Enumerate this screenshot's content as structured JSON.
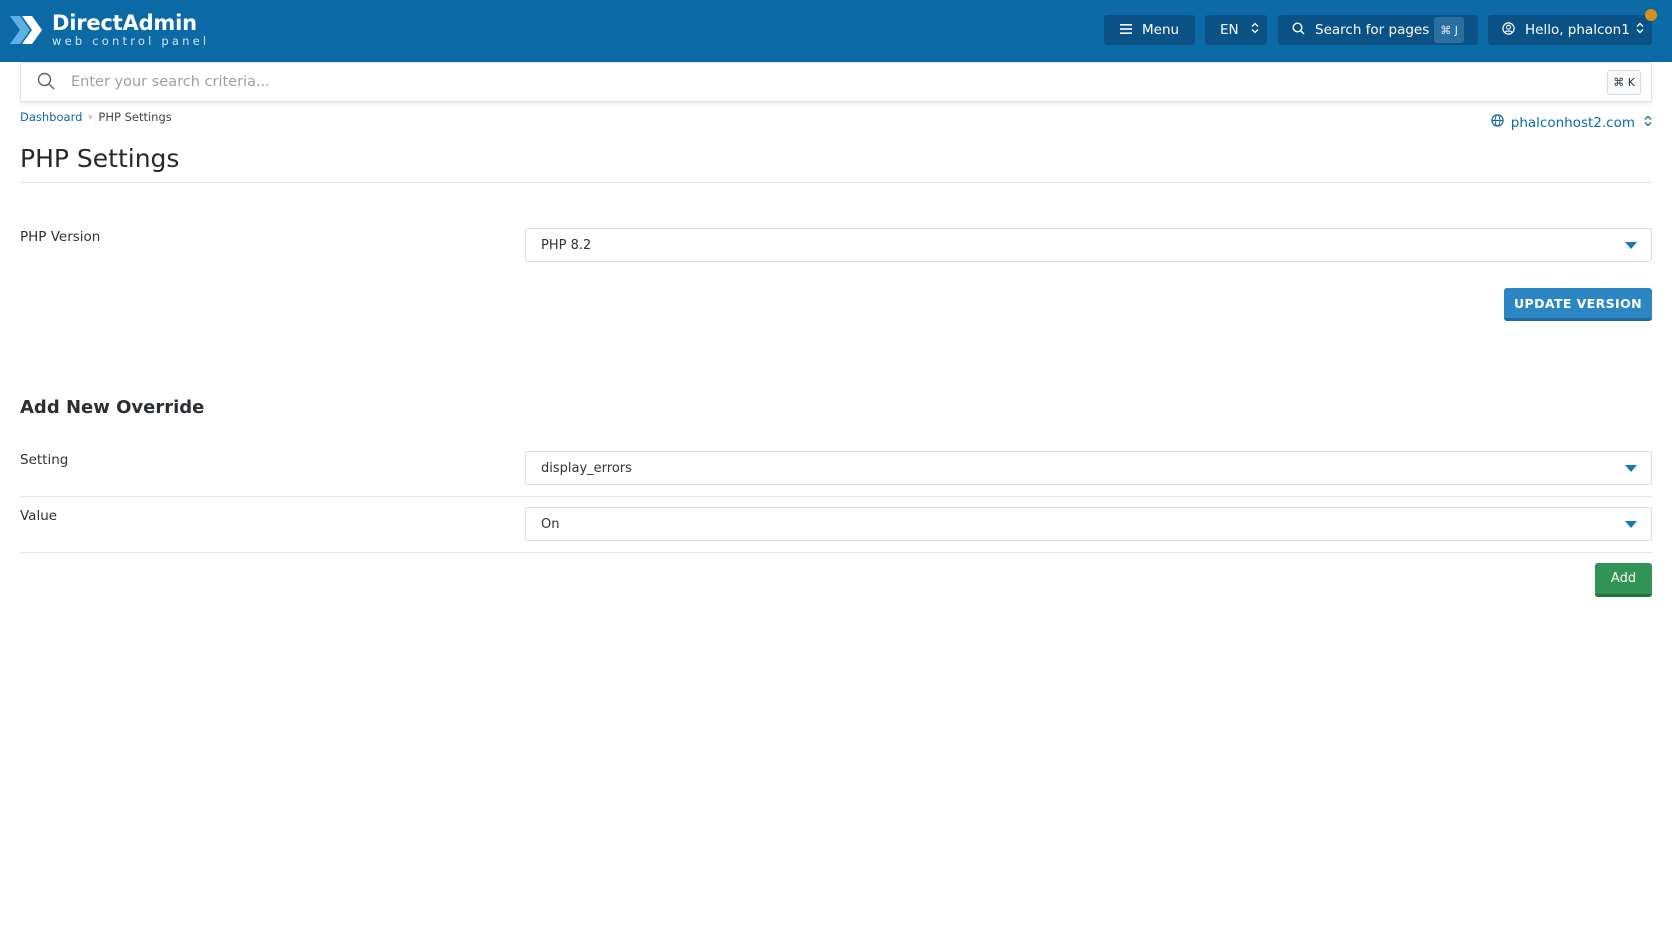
{
  "brand": {
    "name": "DirectAdmin",
    "tagline": "web control panel",
    "colors": {
      "topbar": "#0b6aa6",
      "button_dark": "#0a5286",
      "primary": "#2c86c4",
      "success": "#2f9455",
      "notification": "#d8901a"
    }
  },
  "topbar": {
    "menu_label": "Menu",
    "menu_icon": "hamburger-icon",
    "language": "EN",
    "page_search_label": "Search for pages",
    "page_search_shortcut": "⌘ J",
    "user_label": "Hello, phalcon1",
    "user_icon": "user-circle-icon"
  },
  "global_search": {
    "placeholder": "Enter your search criteria...",
    "shortcut": "⌘ K"
  },
  "breadcrumb": {
    "items": [
      "Dashboard",
      "PHP Settings"
    ]
  },
  "domain_selector": {
    "value": "phalconhost2.com",
    "icon": "globe-icon"
  },
  "page": {
    "title": "PHP Settings",
    "php_version": {
      "label": "PHP Version",
      "selected": "PHP 8.2",
      "button": "UPDATE VERSION"
    },
    "override": {
      "title": "Add New Override",
      "setting_label": "Setting",
      "setting_value": "display_errors",
      "value_label": "Value",
      "value_value": "On",
      "add_button": "Add"
    }
  }
}
